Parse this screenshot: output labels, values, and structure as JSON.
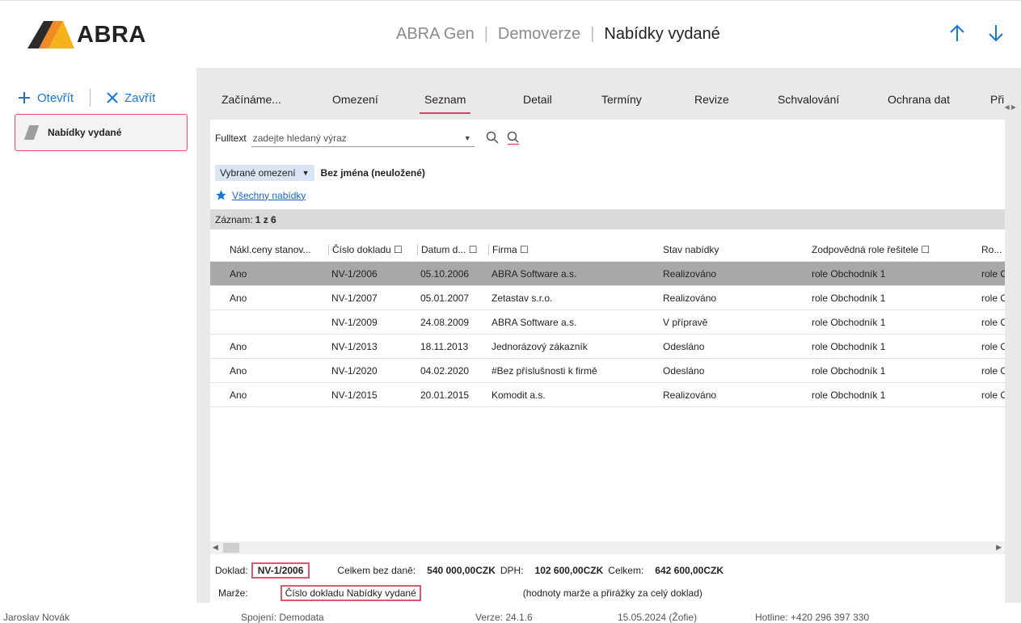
{
  "header": {
    "logo_text": "ABRA",
    "app_name": "ABRA Gen",
    "environment": "Demoverze",
    "page_title": "Nabídky vydané",
    "accent_color": "#1976d2",
    "highlight_color": "#e0566f"
  },
  "sidebar": {
    "open_label": "Otevřít",
    "close_label": "Zavřít",
    "document_card_label": "Nabídky vydané"
  },
  "tabs": [
    {
      "label": "Začínáme..."
    },
    {
      "label": "Omezení"
    },
    {
      "label": "Seznam"
    },
    {
      "label": "Detail"
    },
    {
      "label": "Termíny"
    },
    {
      "label": "Revize"
    },
    {
      "label": "Schvalování"
    },
    {
      "label": "Ochrana dat"
    },
    {
      "label": "Při"
    }
  ],
  "active_tab": "Seznam",
  "search": {
    "label": "Fulltext",
    "placeholder": "zadejte hledaný výraz"
  },
  "filter": {
    "pill_label": "Vybrané omezení",
    "name": "Bez jména (neuložené)",
    "favorite_link": "Všechny nabídky"
  },
  "record": {
    "label": "Záznam:",
    "value": "1 z 6"
  },
  "grid": {
    "columns": [
      "Nákl.ceny stanov...",
      "Číslo dokladu ☐",
      "Datum d... ☐",
      "Firma ☐",
      "Stav nabídky",
      "Zodpovědná role řešitele ☐",
      "Ro..."
    ],
    "rows": [
      [
        "Ano",
        "NV-1/2006",
        "05.10.2006",
        "ABRA Software a.s.",
        "Realizováno",
        "role Obchodník 1",
        "role O"
      ],
      [
        "Ano",
        "NV-1/2007",
        "05.01.2007",
        "Zetastav s.r.o.",
        "Realizováno",
        "role Obchodník 1",
        "role O"
      ],
      [
        "",
        "NV-1/2009",
        "24.08.2009",
        "ABRA Software a.s.",
        "V přípravě",
        "role Obchodník 1",
        "role O"
      ],
      [
        "Ano",
        "NV-1/2013",
        "18.11.2013",
        "Jednorázový zákazník",
        "Odesláno",
        "role Obchodník 1",
        "role O"
      ],
      [
        "Ano",
        "NV-1/2020",
        "04.02.2020",
        "#Bez příslušnosti k firmě",
        "Odesláno",
        "role Obchodník 1",
        "role O"
      ],
      [
        "Ano",
        "NV-1/2015",
        "20.01.2015",
        "Komodit a.s.",
        "Realizováno",
        "role Obchodník 1",
        "role O"
      ]
    ]
  },
  "footer": {
    "doc_label": "Doklad:",
    "doc_value": "NV-1/2006",
    "total_no_vat_label": "Celkem bez daně:",
    "total_no_vat": "540 000,00CZK",
    "vat_label": "DPH:",
    "vat": "102 600,00CZK",
    "total_label": "Celkem:",
    "total": "642 600,00CZK",
    "margin_label": "Marže:",
    "tooltip": "Číslo dokladu Nabídky vydané",
    "margin_note": "(hodnoty marže a přirážky za celý doklad)"
  },
  "status": {
    "user": "Jaroslav Novák",
    "connection": "Spojení: Demodata",
    "version": "Verze: 24.1.6",
    "date": "15.05.2024 (Žofie)",
    "hotline": "Hotline: +420 296 397 330"
  }
}
